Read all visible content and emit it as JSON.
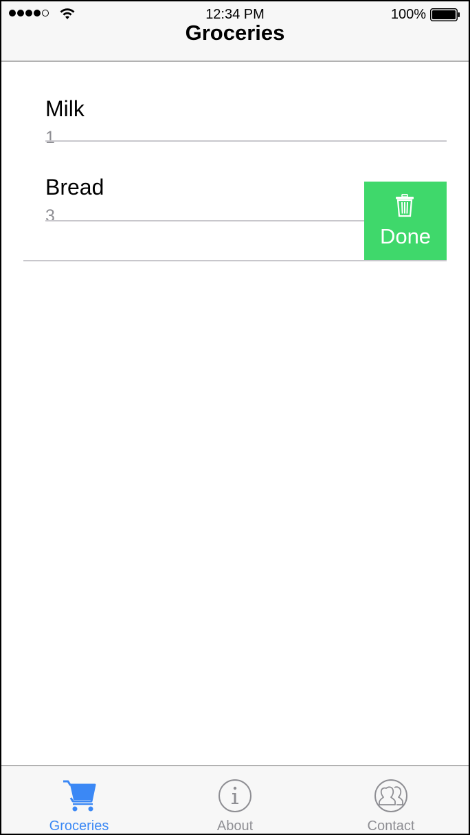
{
  "status_bar": {
    "time": "12:34 PM",
    "battery_percent": "100%",
    "signal_bars_filled": 4,
    "signal_bars_total": 5,
    "battery_level": 1.0
  },
  "nav": {
    "title": "Groceries"
  },
  "items": [
    {
      "name": "Milk",
      "quantity": "1"
    },
    {
      "name": "Bread",
      "quantity": "3"
    }
  ],
  "swipe_action": {
    "label": "Done",
    "icon": "trash-icon",
    "color": "#3fd86b"
  },
  "tabs": [
    {
      "label": "Groceries",
      "icon": "cart-icon",
      "active": true
    },
    {
      "label": "About",
      "icon": "info-icon",
      "active": false
    },
    {
      "label": "Contact",
      "icon": "contacts-icon",
      "active": false
    }
  ],
  "colors": {
    "accent": "#3b88f5",
    "tab_inactive": "#8e8e93",
    "separator": "#c8c7cc"
  }
}
